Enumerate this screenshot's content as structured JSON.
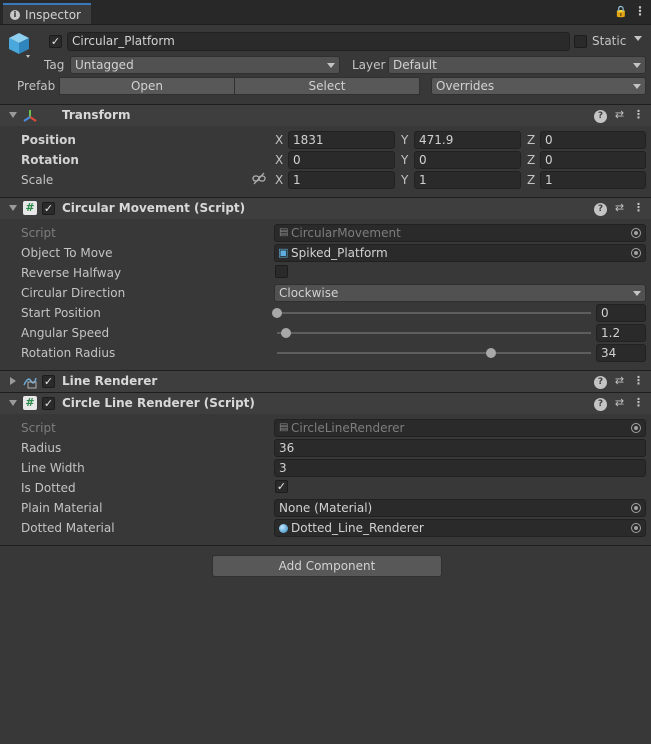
{
  "window": {
    "tab_title": "Inspector"
  },
  "object": {
    "name": "Circular_Platform",
    "static_label": "Static",
    "tag_label": "Tag",
    "tag_value": "Untagged",
    "layer_label": "Layer",
    "layer_value": "Default",
    "prefab_label": "Prefab",
    "open_label": "Open",
    "select_label": "Select",
    "overrides_label": "Overrides"
  },
  "transform": {
    "title": "Transform",
    "position": {
      "label": "Position",
      "x": "1831",
      "y": "471.9",
      "z": "0"
    },
    "rotation": {
      "label": "Rotation",
      "x": "0",
      "y": "0",
      "z": "0"
    },
    "scale": {
      "label": "Scale",
      "x": "1",
      "y": "1",
      "z": "1"
    },
    "axis": {
      "x": "X",
      "y": "Y",
      "z": "Z"
    }
  },
  "circular_movement": {
    "title": "Circular Movement (Script)",
    "script_label": "Script",
    "script_value": "CircularMovement",
    "object_to_move_label": "Object To Move",
    "object_to_move_value": "Spiked_Platform",
    "reverse_halfway_label": "Reverse Halfway",
    "reverse_halfway": false,
    "direction_label": "Circular Direction",
    "direction_value": "Clockwise",
    "start_position_label": "Start Position",
    "start_position": "0",
    "start_position_fraction": 0.0,
    "angular_speed_label": "Angular Speed",
    "angular_speed": "1.2",
    "angular_speed_fraction": 0.03,
    "rotation_radius_label": "Rotation Radius",
    "rotation_radius": "34",
    "rotation_radius_fraction": 0.68
  },
  "line_renderer": {
    "title": "Line Renderer"
  },
  "circle_line_renderer": {
    "title": "Circle Line Renderer (Script)",
    "script_label": "Script",
    "script_value": "CircleLineRenderer",
    "radius_label": "Radius",
    "radius": "36",
    "line_width_label": "Line Width",
    "line_width": "3",
    "is_dotted_label": "Is Dotted",
    "is_dotted": true,
    "plain_material_label": "Plain Material",
    "plain_material": "None (Material)",
    "dotted_material_label": "Dotted Material",
    "dotted_material": "Dotted_Line_Renderer"
  },
  "add_component_label": "Add Component",
  "colors": {
    "accent": "#3a79bb",
    "panel": "#383838",
    "header": "#3e3e3e"
  }
}
